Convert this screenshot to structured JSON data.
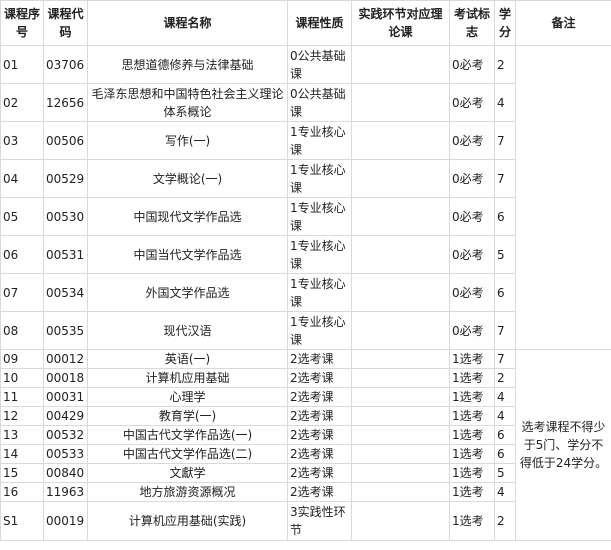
{
  "headers": {
    "no": "课程序号",
    "code": "课程代码",
    "name": "课程名称",
    "nature": "课程性质",
    "practice": "实践环节对应理论课",
    "exam": "考试标志",
    "credit": "学分",
    "note": "备注"
  },
  "rows": [
    {
      "no": "01",
      "code": "03706",
      "name": "思想道德修养与法律基础",
      "nature": "0公共基础课",
      "practice": "",
      "exam": "0必考",
      "credit": "2"
    },
    {
      "no": "02",
      "code": "12656",
      "name": "毛泽东思想和中国特色社会主义理论体系概论",
      "nature": "0公共基础课",
      "practice": "",
      "exam": "0必考",
      "credit": "4"
    },
    {
      "no": "03",
      "code": "00506",
      "name": "写作(一)",
      "nature": "1专业核心课",
      "practice": "",
      "exam": "0必考",
      "credit": "7"
    },
    {
      "no": "04",
      "code": "00529",
      "name": "文学概论(一)",
      "nature": "1专业核心课",
      "practice": "",
      "exam": "0必考",
      "credit": "7"
    },
    {
      "no": "05",
      "code": "00530",
      "name": "中国现代文学作品选",
      "nature": "1专业核心课",
      "practice": "",
      "exam": "0必考",
      "credit": "6"
    },
    {
      "no": "06",
      "code": "00531",
      "name": "中国当代文学作品选",
      "nature": "1专业核心课",
      "practice": "",
      "exam": "0必考",
      "credit": "5"
    },
    {
      "no": "07",
      "code": "00534",
      "name": "外国文学作品选",
      "nature": "1专业核心课",
      "practice": "",
      "exam": "0必考",
      "credit": "6"
    },
    {
      "no": "08",
      "code": "00535",
      "name": "现代汉语",
      "nature": "1专业核心课",
      "practice": "",
      "exam": "0必考",
      "credit": "7"
    },
    {
      "no": "09",
      "code": "00012",
      "name": "英语(一)",
      "nature": "2选考课",
      "practice": "",
      "exam": "1选考",
      "credit": "7"
    },
    {
      "no": "10",
      "code": "00018",
      "name": "计算机应用基础",
      "nature": "2选考课",
      "practice": "",
      "exam": "1选考",
      "credit": "2"
    },
    {
      "no": "11",
      "code": "00031",
      "name": "心理学",
      "nature": "2选考课",
      "practice": "",
      "exam": "1选考",
      "credit": "4"
    },
    {
      "no": "12",
      "code": "00429",
      "name": "教育学(一)",
      "nature": "2选考课",
      "practice": "",
      "exam": "1选考",
      "credit": "4"
    },
    {
      "no": "13",
      "code": "00532",
      "name": "中国古代文学作品选(一)",
      "nature": "2选考课",
      "practice": "",
      "exam": "1选考",
      "credit": "6"
    },
    {
      "no": "14",
      "code": "00533",
      "name": "中国古代文学作品选(二)",
      "nature": "2选考课",
      "practice": "",
      "exam": "1选考",
      "credit": "6"
    },
    {
      "no": "15",
      "code": "00840",
      "name": "文獻学",
      "nature": "2选考课",
      "practice": "",
      "exam": "1选考",
      "credit": "5"
    },
    {
      "no": "16",
      "code": "11963",
      "name": "地方旅游资源概况",
      "nature": "2选考课",
      "practice": "",
      "exam": "1选考",
      "credit": "4"
    },
    {
      "no": "S1",
      "code": "00019",
      "name": "计算机应用基础(实践)",
      "nature": "3实践性环节",
      "practice": "",
      "exam": "1选考",
      "credit": "2"
    }
  ],
  "note_text": "选考课程不得少于5门、学分不得低于24学分。"
}
